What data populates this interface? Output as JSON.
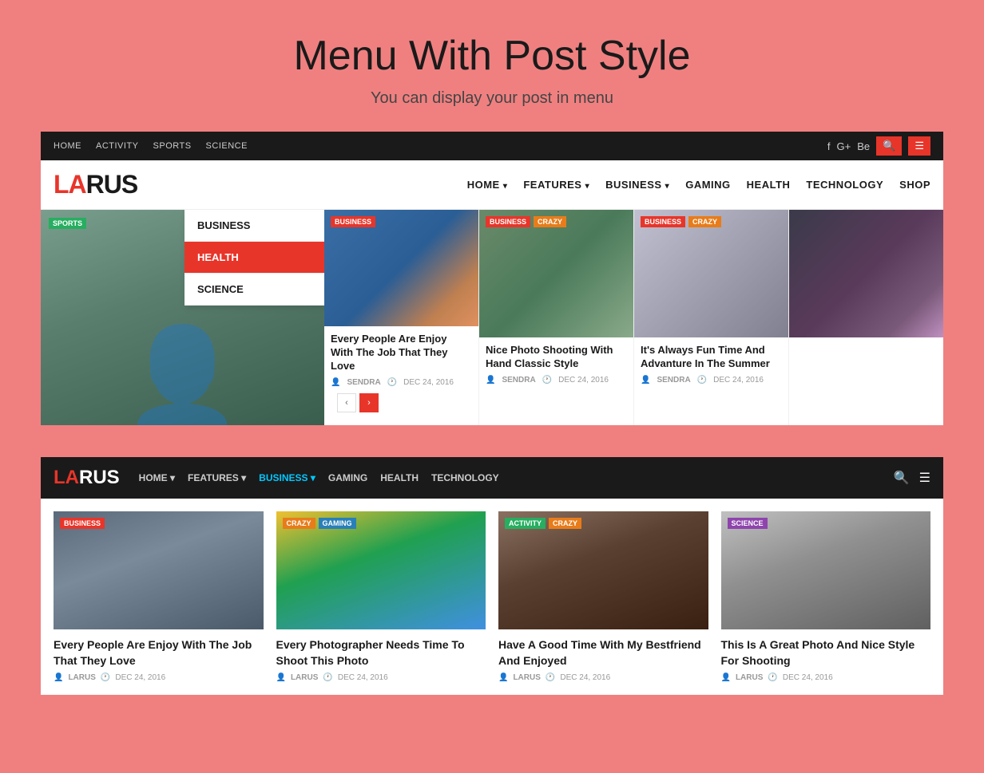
{
  "page": {
    "title": "Menu With Post Style",
    "subtitle": "You can display your post in menu"
  },
  "topNav": {
    "links": [
      "HOME",
      "ACTIVITY",
      "SPORTS",
      "SCIENCE"
    ],
    "socialIcons": [
      "f",
      "G+",
      "Be"
    ],
    "searchLabel": "🔍",
    "menuLabel": "☰"
  },
  "logoNav": {
    "logoLA": "LA",
    "logoRUS": "RUS",
    "links": [
      "HOME",
      "FEATURES",
      "BUSINESS",
      "GAMING",
      "HEALTH",
      "TECHNOLOGY",
      "SHOP"
    ]
  },
  "featuredLeft": {
    "badge": "SPORTS"
  },
  "dropdownMenu": {
    "items": [
      {
        "label": "BUSINESS",
        "active": false
      },
      {
        "label": "HEALTH",
        "active": true
      },
      {
        "label": "SCIENCE",
        "active": false
      }
    ]
  },
  "articleCards": [
    {
      "badges": [
        {
          "label": "BUSINESS",
          "type": "business"
        }
      ],
      "title": "Every People Are Enjoy With The Job That They Love",
      "author": "SENDRA",
      "date": "DEC 24, 2016",
      "imgClass": "card-img-1"
    },
    {
      "badges": [
        {
          "label": "BUSINESS",
          "type": "business"
        },
        {
          "label": "CRAZY",
          "type": "crazy"
        }
      ],
      "title": "Nice Photo Shooting With Hand Classic Style",
      "author": "SENDRA",
      "date": "DEC 24, 2016",
      "imgClass": "card-img-2"
    },
    {
      "badges": [
        {
          "label": "BUSINESS",
          "type": "business"
        },
        {
          "label": "CRAZY",
          "type": "crazy"
        }
      ],
      "title": "It's Always Fun Time And Advanture In The Summer",
      "author": "SENDRA",
      "date": "DEC 24, 2016",
      "imgClass": "card-img-3"
    },
    {
      "badges": [],
      "title": "",
      "author": "",
      "date": "",
      "imgClass": "card-img-4"
    }
  ],
  "darkNav": {
    "logoLA": "LA",
    "logoRUS": "RUS",
    "links": [
      {
        "label": "HOME",
        "active": false,
        "arrow": true
      },
      {
        "label": "FEATURES",
        "active": false,
        "arrow": true
      },
      {
        "label": "BUSINESS",
        "active": true,
        "arrow": true
      },
      {
        "label": "GAMING",
        "active": false
      },
      {
        "label": "HEALTH",
        "active": false
      },
      {
        "label": "TECHNOLOGY",
        "active": false
      }
    ]
  },
  "gridCards": [
    {
      "badges": [
        {
          "label": "BUSINESS",
          "type": "business"
        }
      ],
      "title": "Every People Are Enjoy With The Job That They Love",
      "author": "LARUS",
      "date": "DEC 24, 2016",
      "imgClass": "gc-img-1"
    },
    {
      "badges": [
        {
          "label": "CRAZY",
          "type": "crazy"
        },
        {
          "label": "GAMING",
          "type": "gaming"
        }
      ],
      "title": "Every Photographer Needs Time To Shoot This Photo",
      "author": "LARUS",
      "date": "DEC 24, 2016",
      "imgClass": "gc-img-2"
    },
    {
      "badges": [
        {
          "label": "ACTIVITY",
          "type": "activity"
        },
        {
          "label": "CRAZY",
          "type": "crazy"
        }
      ],
      "title": "Have A Good Time With My Bestfriend And Enjoyed",
      "author": "LARUS",
      "date": "DEC 24, 2016",
      "imgClass": "gc-img-3"
    },
    {
      "badges": [
        {
          "label": "SCIENCE",
          "type": "science"
        }
      ],
      "title": "This Is A Great Photo And Nice Style For Shooting",
      "author": "LARUS",
      "date": "DEC 24, 2016",
      "imgClass": "gc-img-4"
    }
  ]
}
